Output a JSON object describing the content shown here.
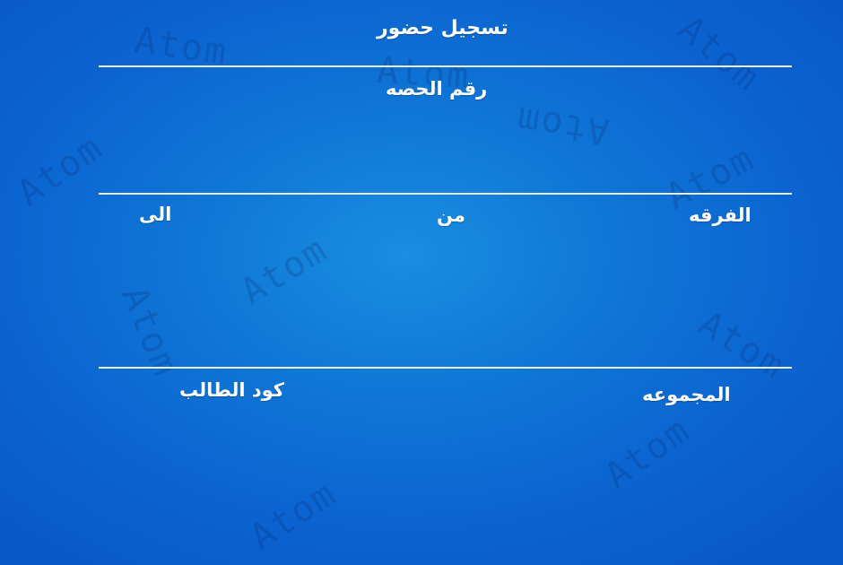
{
  "header": {
    "title": "تسجيل حضور",
    "session_label": "رقم الحصه"
  },
  "row1": {
    "grade_label": "الفرقه",
    "from_label": "من",
    "to_label": "الى"
  },
  "row2": {
    "group_label": "المجموعه",
    "student_code_label": "كود الطالب"
  },
  "watermark_text": "Atom"
}
